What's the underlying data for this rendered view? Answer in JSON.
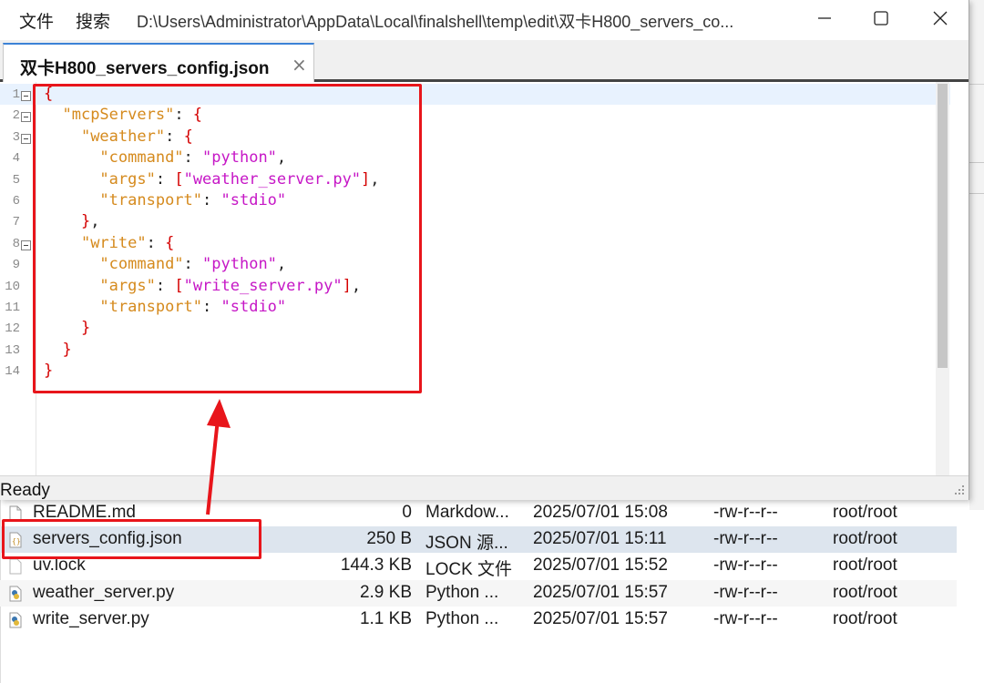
{
  "window": {
    "menu": [
      "文件",
      "搜索"
    ],
    "title": "D:\\Users\\Administrator\\AppData\\Local\\finalshell\\temp\\edit\\双卡H800_servers_co...",
    "controls": [
      "minimize-icon",
      "maximize-icon",
      "close-icon"
    ]
  },
  "tab": {
    "label": "双卡H800_servers_config.json",
    "close": "×"
  },
  "status": "Ready",
  "colors": {
    "annotation": "#e8151b",
    "key": "#d58a1d",
    "string": "#c617c6",
    "punct": "#d40000"
  },
  "code": [
    [
      {
        "t": "{",
        "c": "pun"
      }
    ],
    [
      {
        "t": "  "
      },
      {
        "t": "\"mcpServers\"",
        "c": "key"
      },
      {
        "t": ": ",
        "c": "plain"
      },
      {
        "t": "{",
        "c": "pun"
      }
    ],
    [
      {
        "t": "    "
      },
      {
        "t": "\"weather\"",
        "c": "key"
      },
      {
        "t": ": ",
        "c": "plain"
      },
      {
        "t": "{",
        "c": "pun"
      }
    ],
    [
      {
        "t": "      "
      },
      {
        "t": "\"command\"",
        "c": "key"
      },
      {
        "t": ": ",
        "c": "plain"
      },
      {
        "t": "\"python\"",
        "c": "str"
      },
      {
        "t": ",",
        "c": "plain"
      }
    ],
    [
      {
        "t": "      "
      },
      {
        "t": "\"args\"",
        "c": "key"
      },
      {
        "t": ": ",
        "c": "plain"
      },
      {
        "t": "[",
        "c": "pun"
      },
      {
        "t": "\"weather_server.py\"",
        "c": "str"
      },
      {
        "t": "]",
        "c": "pun"
      },
      {
        "t": ",",
        "c": "plain"
      }
    ],
    [
      {
        "t": "      "
      },
      {
        "t": "\"transport\"",
        "c": "key"
      },
      {
        "t": ": ",
        "c": "plain"
      },
      {
        "t": "\"stdio\"",
        "c": "str"
      }
    ],
    [
      {
        "t": "    "
      },
      {
        "t": "}",
        "c": "pun"
      },
      {
        "t": ",",
        "c": "plain"
      }
    ],
    [
      {
        "t": "    "
      },
      {
        "t": "\"write\"",
        "c": "key"
      },
      {
        "t": ": ",
        "c": "plain"
      },
      {
        "t": "{",
        "c": "pun"
      }
    ],
    [
      {
        "t": "      "
      },
      {
        "t": "\"command\"",
        "c": "key"
      },
      {
        "t": ": ",
        "c": "plain"
      },
      {
        "t": "\"python\"",
        "c": "str"
      },
      {
        "t": ",",
        "c": "plain"
      }
    ],
    [
      {
        "t": "      "
      },
      {
        "t": "\"args\"",
        "c": "key"
      },
      {
        "t": ": ",
        "c": "plain"
      },
      {
        "t": "[",
        "c": "pun"
      },
      {
        "t": "\"write_server.py\"",
        "c": "str"
      },
      {
        "t": "]",
        "c": "pun"
      },
      {
        "t": ",",
        "c": "plain"
      }
    ],
    [
      {
        "t": "      "
      },
      {
        "t": "\"transport\"",
        "c": "key"
      },
      {
        "t": ": ",
        "c": "plain"
      },
      {
        "t": "\"stdio\"",
        "c": "str"
      }
    ],
    [
      {
        "t": "    "
      },
      {
        "t": "}",
        "c": "pun"
      }
    ],
    [
      {
        "t": "  "
      },
      {
        "t": "}",
        "c": "pun"
      }
    ],
    [
      {
        "t": "}",
        "c": "pun"
      }
    ]
  ],
  "line_numbers": [
    "1",
    "2",
    "3",
    "4",
    "5",
    "6",
    "7",
    "8",
    "9",
    "10",
    "11",
    "12",
    "13",
    "14"
  ],
  "fold_lines": [
    1,
    2,
    3,
    8
  ],
  "files": [
    {
      "name": "README.md",
      "size": "0",
      "type": "Markdow...",
      "date": "2025/07/01 15:08",
      "perm": "-rw-r--r--",
      "owner": "root/root",
      "icon": "document-icon"
    },
    {
      "name": "servers_config.json",
      "size": "250 B",
      "type": "JSON 源...",
      "date": "2025/07/01 15:11",
      "perm": "-rw-r--r--",
      "owner": "root/root",
      "icon": "json-file-icon"
    },
    {
      "name": "uv.lock",
      "size": "144.3 KB",
      "type": "LOCK 文件",
      "date": "2025/07/01 15:52",
      "perm": "-rw-r--r--",
      "owner": "root/root",
      "icon": "document-icon"
    },
    {
      "name": "weather_server.py",
      "size": "2.9 KB",
      "type": "Python ...",
      "date": "2025/07/01 15:57",
      "perm": "-rw-r--r--",
      "owner": "root/root",
      "icon": "python-file-icon"
    },
    {
      "name": "write_server.py",
      "size": "1.1 KB",
      "type": "Python ...",
      "date": "2025/07/01 15:57",
      "perm": "-rw-r--r--",
      "owner": "root/root",
      "icon": "python-file-icon"
    }
  ]
}
